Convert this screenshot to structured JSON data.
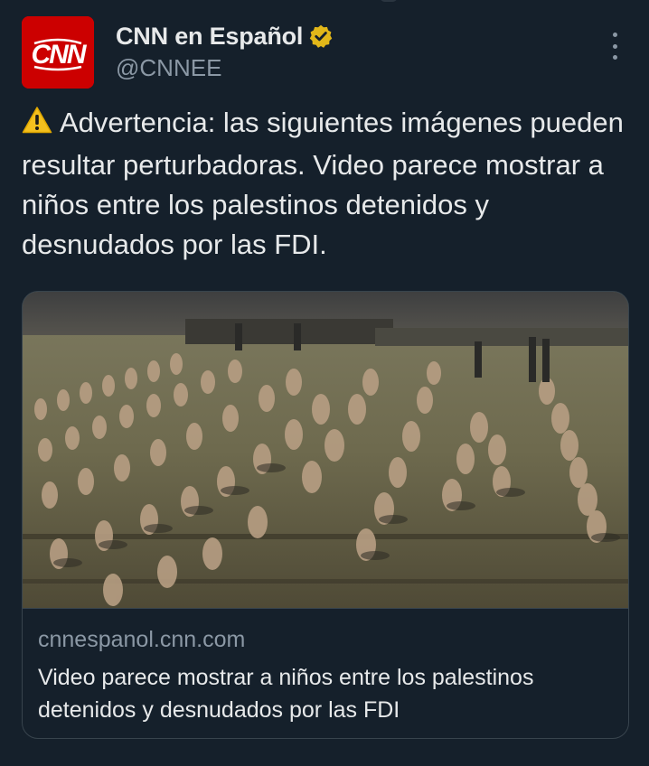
{
  "author": {
    "display_name": "CNN en Español",
    "handle": "@CNNEE",
    "avatar_logo_text": "CNN",
    "avatar_color": "#cc0000",
    "verified_badge_color": "#e2b719"
  },
  "post": {
    "text": "Advertencia: las siguientes imágenes pueden resultar perturbadoras. Video parece mostrar a niños entre los palestinos detenidos y desnudados por las FDI.",
    "leading_icon": "warning-icon"
  },
  "link_card": {
    "image_description_icon": "photo",
    "domain": "cnnespanol.cnn.com",
    "title": "Video parece mostrar a niños entre los palestinos detenidos y desnudados por las FDI"
  },
  "theme": {
    "background": "#15202b",
    "text_primary": "#e7e9ea",
    "text_secondary": "#8b98a5",
    "border": "#38444d"
  }
}
